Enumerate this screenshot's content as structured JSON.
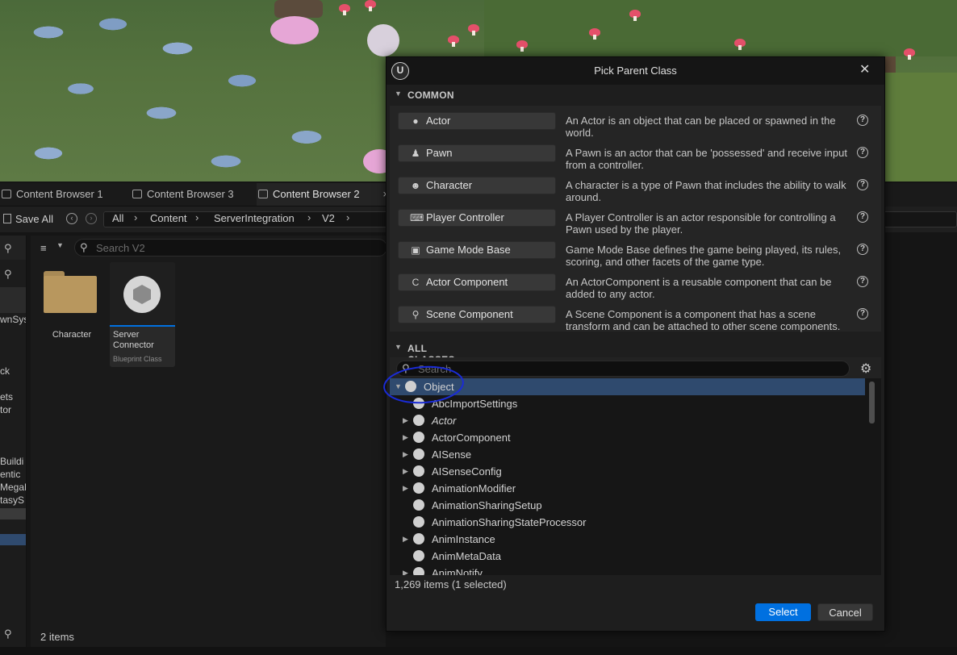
{
  "content_browser": {
    "tabs": [
      {
        "label": "Content Browser 1"
      },
      {
        "label": "Content Browser 3"
      },
      {
        "label": "Content Browser 2"
      }
    ],
    "tab_close_glyph": "×",
    "toolbar": {
      "save_all": "Save All"
    },
    "breadcrumbs": [
      "All",
      "Content",
      "ServerIntegration",
      "V2"
    ],
    "search_placeholder": "Search V2",
    "left_fragments": [
      "wnSys",
      "ck",
      "ets",
      "tor",
      "Buildi",
      "entic",
      "MegaE",
      "tasyS"
    ],
    "assets": [
      {
        "label": "Character"
      },
      {
        "label": "Server Connector",
        "sublabel": "Blueprint Class"
      }
    ],
    "item_count": "2 items"
  },
  "dialog": {
    "title": "Pick Parent Class",
    "close_glyph": "✕",
    "common_header": "COMMON",
    "all_classes_header": "ALL CLASSES",
    "common": [
      {
        "label": "Actor",
        "icon": "actor-icon",
        "glyph": "●",
        "desc": "An Actor is an object that can be placed or spawned in the world."
      },
      {
        "label": "Pawn",
        "icon": "pawn-icon",
        "glyph": "♟",
        "desc": "A Pawn is an actor that can be 'possessed' and receive input from a controller."
      },
      {
        "label": "Character",
        "icon": "character-icon",
        "glyph": "☻",
        "desc": "A character is a type of Pawn that includes the ability to walk around."
      },
      {
        "label": "Player Controller",
        "icon": "gamepad-icon",
        "glyph": "⌨",
        "desc": "A Player Controller is an actor responsible for controlling a Pawn used by the player."
      },
      {
        "label": "Game Mode Base",
        "icon": "image-icon",
        "glyph": "▣",
        "desc": "Game Mode Base defines the game being played, its rules, scoring, and other facets of the game type."
      },
      {
        "label": "Actor Component",
        "icon": "component-icon",
        "glyph": "C",
        "desc": "An ActorComponent is a reusable component that can be added to any actor."
      },
      {
        "label": "Scene Component",
        "icon": "scene-component-icon",
        "glyph": "⚲",
        "desc": "A Scene Component is a component that has a scene transform and can be attached to other scene components."
      }
    ],
    "search_placeholder": "Search",
    "classes": [
      {
        "label": "Object",
        "expandable": true,
        "expanded": true,
        "selected": true,
        "level": 0
      },
      {
        "label": "AbcImportSettings",
        "expandable": false,
        "level": 1
      },
      {
        "label": "Actor",
        "expandable": true,
        "level": 1,
        "italic": true
      },
      {
        "label": "ActorComponent",
        "expandable": true,
        "level": 1
      },
      {
        "label": "AISense",
        "expandable": true,
        "level": 1
      },
      {
        "label": "AISenseConfig",
        "expandable": true,
        "level": 1
      },
      {
        "label": "AnimationModifier",
        "expandable": true,
        "level": 1
      },
      {
        "label": "AnimationSharingSetup",
        "expandable": false,
        "level": 1
      },
      {
        "label": "AnimationSharingStateProcessor",
        "expandable": false,
        "level": 1
      },
      {
        "label": "AnimInstance",
        "expandable": true,
        "level": 1
      },
      {
        "label": "AnimMetaData",
        "expandable": false,
        "level": 1
      },
      {
        "label": "AnimNotify",
        "expandable": true,
        "level": 1
      }
    ],
    "status": "1,269 items (1 selected)",
    "select_label": "Select",
    "cancel_label": "Cancel",
    "colors": {
      "accent": "#0070e0",
      "selected_row": "#2f4a6e",
      "annotation": "#1a2bd6"
    }
  }
}
